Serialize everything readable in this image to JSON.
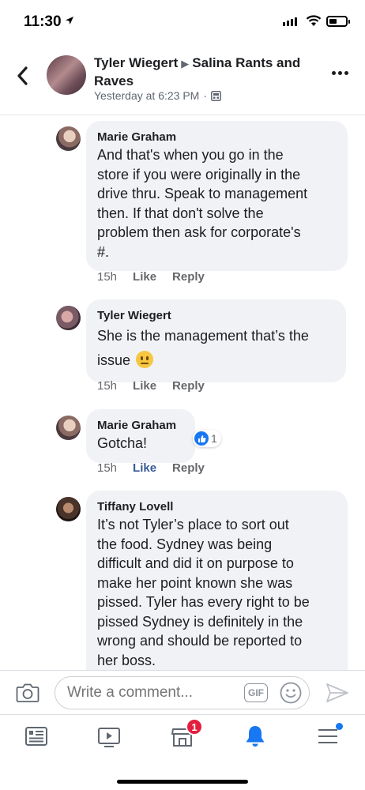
{
  "status": {
    "time": "11:30"
  },
  "header": {
    "author": "Tyler Wiegert",
    "group": "Salina Rants and Raves",
    "timestamp": "Yesterday at 6:23 PM",
    "separator": "·"
  },
  "comments": [
    {
      "author": "Marie Graham",
      "lines": [
        "And that's when you go in the",
        "store if you were originally in the",
        "drive thru.  Speak to management",
        "then.  If that don't solve the",
        "problem then ask for corporate's",
        "#."
      ],
      "time": "15h",
      "like": "Like",
      "reply": "Reply"
    },
    {
      "author": "Tyler Wiegert",
      "lines": [
        "She is the management that’s the",
        "issue"
      ],
      "emoji": "neutral-face",
      "time": "15h",
      "like": "Like",
      "reply": "Reply"
    },
    {
      "author": "Marie Graham",
      "lines": [
        "Gotcha!"
      ],
      "reaction_count": "1",
      "time": "15h",
      "like": "Like",
      "reply": "Reply",
      "liked": true
    },
    {
      "author": "Tiffany Lovell",
      "lines": [
        "It’s not Tyler’s place to sort out",
        "the food. Sydney was being",
        "difficult and did it on purpose to",
        "make her point known she was",
        "pissed. Tyler has every right to be",
        "pissed Sydney is definitely in the",
        "wrong and should be reported to",
        "her boss."
      ]
    }
  ],
  "composer": {
    "placeholder": "Write a comment...",
    "gif_label": "GIF"
  },
  "tabbar": {
    "items": [
      "news-feed",
      "watch",
      "marketplace",
      "notifications",
      "menu"
    ],
    "marketplace_badge": "1",
    "active": "notifications"
  },
  "colors": {
    "accent": "#1877f2",
    "liked": "#385898",
    "bubble": "#f0f2f5",
    "badge": "#e41e3f"
  }
}
